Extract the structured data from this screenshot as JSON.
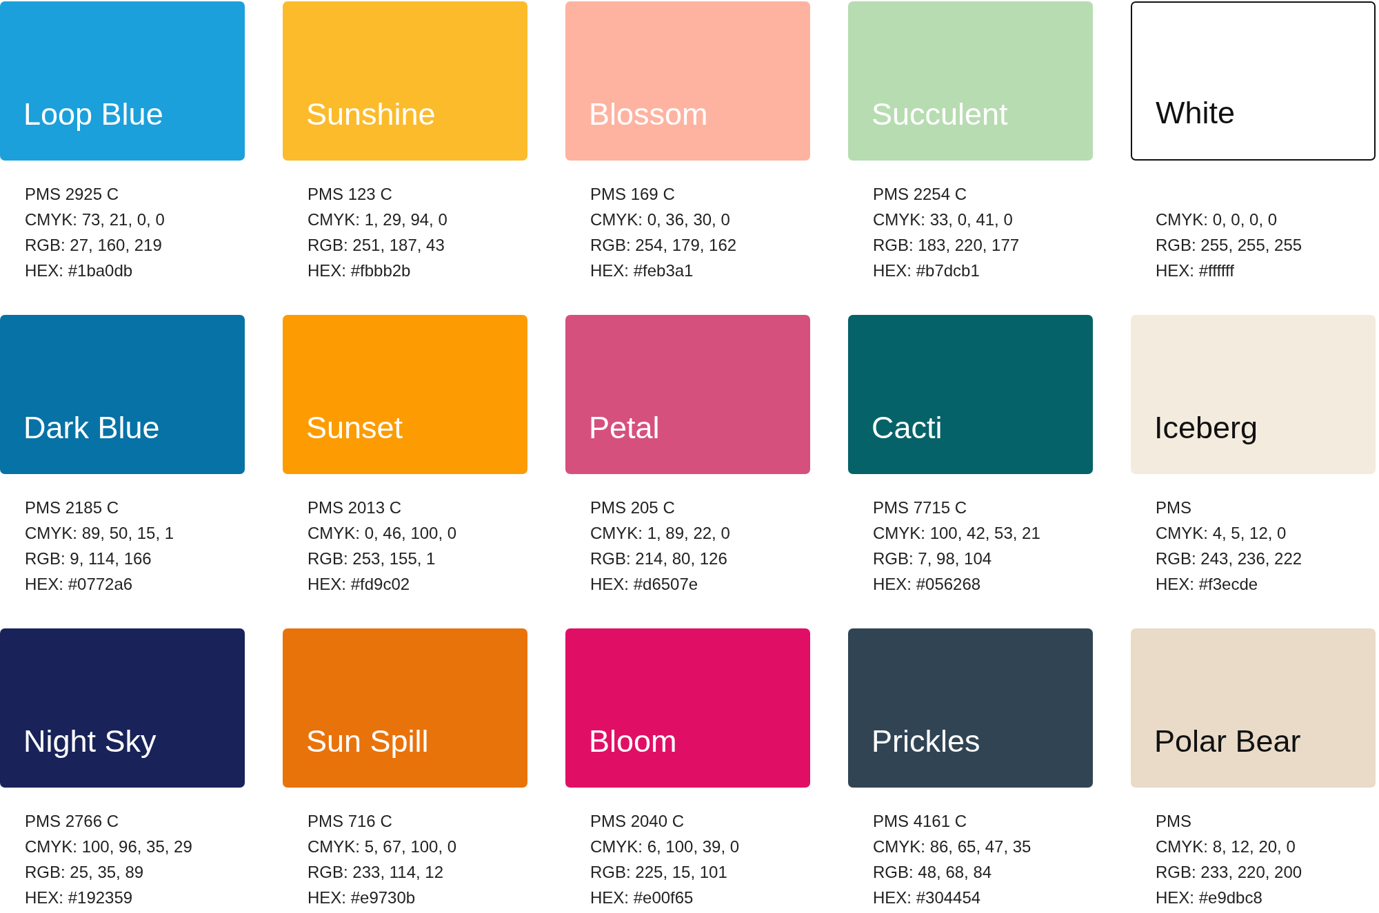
{
  "swatches": [
    {
      "name": "Loop Blue",
      "color": "#1ba0db",
      "dark_text": false,
      "bordered": false,
      "details": [
        "PMS 2925 C",
        "CMYK: 73, 21, 0, 0",
        "RGB: 27, 160, 219",
        "HEX: #1ba0db"
      ]
    },
    {
      "name": "Sunshine",
      "color": "#fbbb2b",
      "dark_text": false,
      "bordered": false,
      "details": [
        "PMS 123 C",
        "CMYK: 1, 29, 94, 0",
        "RGB: 251, 187, 43",
        "HEX: #fbbb2b"
      ]
    },
    {
      "name": "Blossom",
      "color": "#feb3a1",
      "dark_text": false,
      "bordered": false,
      "details": [
        "PMS 169 C",
        "CMYK: 0, 36, 30, 0",
        "RGB: 254, 179, 162",
        "HEX: #feb3a1"
      ]
    },
    {
      "name": "Succulent",
      "color": "#b7dcb1",
      "dark_text": false,
      "bordered": false,
      "details": [
        "PMS 2254 C",
        "CMYK: 33, 0, 41, 0",
        "RGB: 183, 220, 177",
        "HEX: #b7dcb1"
      ]
    },
    {
      "name": "White",
      "color": "#ffffff",
      "dark_text": true,
      "bordered": true,
      "details": [
        "CMYK: 0, 0, 0, 0",
        "RGB: 255, 255, 255",
        "HEX: #ffffff"
      ]
    },
    {
      "name": "Dark Blue",
      "color": "#0772a6",
      "dark_text": false,
      "bordered": false,
      "details": [
        "PMS 2185 C",
        "CMYK: 89, 50, 15, 1",
        "RGB: 9, 114, 166",
        "HEX: #0772a6"
      ]
    },
    {
      "name": "Sunset",
      "color": "#fd9c02",
      "dark_text": false,
      "bordered": false,
      "details": [
        "PMS 2013 C",
        "CMYK: 0, 46, 100, 0",
        "RGB: 253, 155, 1",
        "HEX: #fd9c02"
      ]
    },
    {
      "name": "Petal",
      "color": "#d6507e",
      "dark_text": false,
      "bordered": false,
      "details": [
        "PMS 205 C",
        "CMYK: 1, 89, 22, 0",
        "RGB: 214, 80, 126",
        "HEX: #d6507e"
      ]
    },
    {
      "name": "Cacti",
      "color": "#056268",
      "dark_text": false,
      "bordered": false,
      "details": [
        "PMS 7715 C",
        "CMYK: 100, 42, 53, 21",
        "RGB: 7, 98, 104",
        "HEX: #056268"
      ]
    },
    {
      "name": "Iceberg",
      "color": "#f3ecde",
      "dark_text": true,
      "bordered": false,
      "details": [
        "PMS",
        "CMYK: 4, 5, 12, 0",
        "RGB: 243, 236, 222",
        "HEX: #f3ecde"
      ]
    },
    {
      "name": "Night Sky",
      "color": "#192359",
      "dark_text": false,
      "bordered": false,
      "details": [
        "PMS 2766 C",
        "CMYK: 100, 96, 35, 29",
        "RGB: 25, 35, 89",
        "HEX: #192359"
      ]
    },
    {
      "name": "Sun Spill",
      "color": "#e9730b",
      "dark_text": false,
      "bordered": false,
      "details": [
        "PMS 716 C",
        "CMYK: 5, 67, 100, 0",
        "RGB: 233, 114, 12",
        "HEX: #e9730b"
      ]
    },
    {
      "name": "Bloom",
      "color": "#e00f65",
      "dark_text": false,
      "bordered": false,
      "details": [
        "PMS 2040 C",
        "CMYK: 6, 100, 39, 0",
        "RGB: 225, 15, 101",
        "HEX: #e00f65"
      ]
    },
    {
      "name": "Prickles",
      "color": "#304454",
      "dark_text": false,
      "bordered": false,
      "details": [
        "PMS 4161 C",
        "CMYK: 86, 65, 47, 35",
        "RGB: 48, 68, 84",
        "HEX: #304454"
      ]
    },
    {
      "name": "Polar Bear",
      "color": "#e9dbc8",
      "dark_text": true,
      "bordered": false,
      "details": [
        "PMS",
        "CMYK: 8, 12, 20, 0",
        "RGB: 233, 220, 200",
        "HEX: #e9dbc8"
      ]
    }
  ]
}
